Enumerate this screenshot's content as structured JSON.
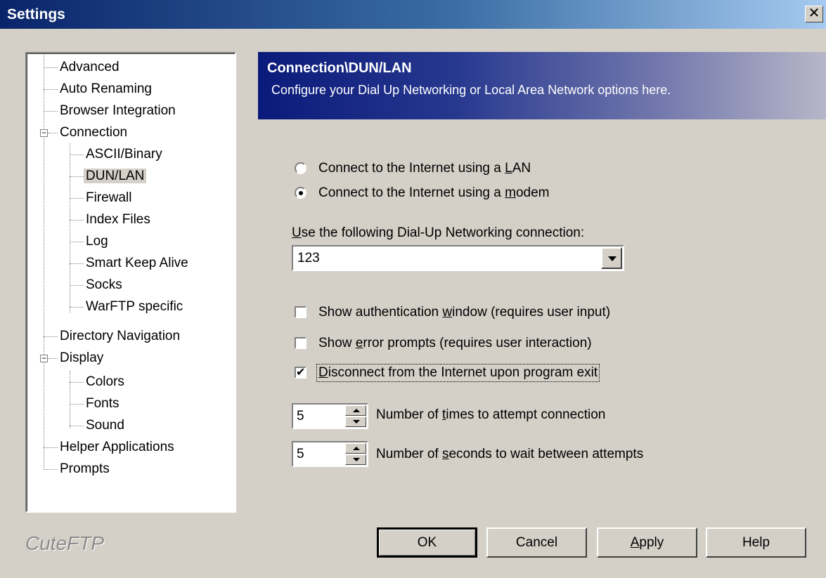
{
  "window": {
    "title": "Settings",
    "close_glyph": "✕"
  },
  "tree": {
    "items": [
      {
        "label": "Advanced"
      },
      {
        "label": "Auto Renaming"
      },
      {
        "label": "Browser Integration"
      },
      {
        "label": "Connection",
        "expanded": true
      },
      {
        "label": "ASCII/Binary"
      },
      {
        "label": "DUN/LAN",
        "selected": true
      },
      {
        "label": "Firewall"
      },
      {
        "label": "Index Files"
      },
      {
        "label": "Log"
      },
      {
        "label": "Smart Keep Alive"
      },
      {
        "label": "Socks"
      },
      {
        "label": "WarFTP specific"
      },
      {
        "label": "Directory Navigation"
      },
      {
        "label": "Display",
        "expanded": true
      },
      {
        "label": "Colors"
      },
      {
        "label": "Fonts"
      },
      {
        "label": "Sound"
      },
      {
        "label": "Helper Applications"
      },
      {
        "label": "Prompts"
      }
    ],
    "expander_glyph": "−"
  },
  "logo": "CuteFTP",
  "banner": {
    "title": "Connection\\DUN/LAN",
    "description": "Configure your Dial Up Networking or Local Area Network options here."
  },
  "connection_mode": {
    "lan": {
      "pre": "Connect to the Internet using a ",
      "key": "L",
      "post": "AN",
      "selected": false
    },
    "modem": {
      "pre": "Connect to the Internet using a ",
      "key": "m",
      "post": "odem",
      "selected": true
    }
  },
  "dun": {
    "label_key": "U",
    "label_rest": "se the following Dial-Up Networking connection:",
    "value": "123"
  },
  "options": {
    "auth": {
      "pre": "Show authentication ",
      "key": "w",
      "post": "indow (requires user input)",
      "checked": false
    },
    "errors": {
      "pre": "Show ",
      "key": "e",
      "post": "rror prompts (requires user interaction)",
      "checked": false
    },
    "disconnect": {
      "pre": "",
      "key": "D",
      "post": "isconnect from the Internet upon program exit",
      "checked": true
    },
    "check_glyph": "✔"
  },
  "attempts": {
    "value": "5",
    "pre": "Number of ",
    "key": "t",
    "post": "imes to attempt connection"
  },
  "wait": {
    "value": "5",
    "pre": "Number of ",
    "key": "s",
    "post": "econds to wait between attempts"
  },
  "buttons": {
    "ok": "OK",
    "cancel": "Cancel",
    "apply_key": "A",
    "apply_rest": "pply",
    "help": "Help"
  }
}
